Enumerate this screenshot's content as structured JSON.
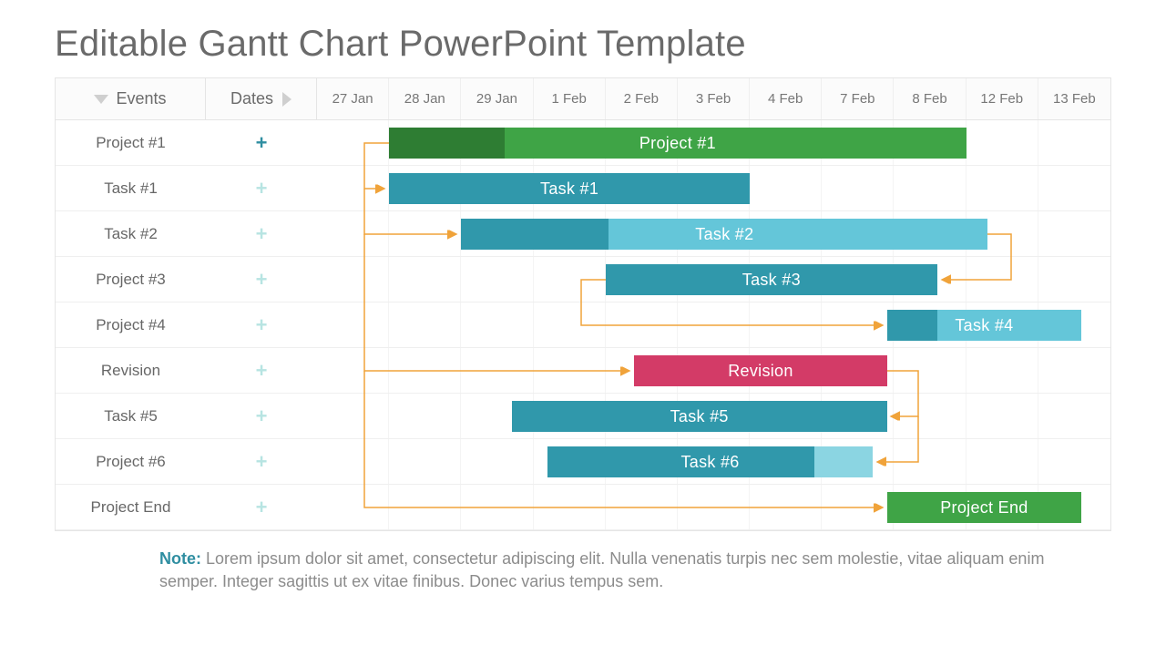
{
  "title": "Editable Gantt Chart PowerPoint Template",
  "columns": {
    "events": "Events",
    "dates": "Dates"
  },
  "timeline": [
    "27 Jan",
    "28 Jan",
    "29 Jan",
    "1 Feb",
    "2 Feb",
    "3 Feb",
    "4 Feb",
    "7 Feb",
    "8 Feb",
    "12 Feb",
    "13 Feb"
  ],
  "rows": [
    {
      "label": "Project #1",
      "icon": "plus-strong"
    },
    {
      "label": "Task #1",
      "icon": "plus"
    },
    {
      "label": "Task #2",
      "icon": "plus"
    },
    {
      "label": "Project #3",
      "icon": "plus"
    },
    {
      "label": "Project #4",
      "icon": "plus"
    },
    {
      "label": "Revision",
      "icon": "plus"
    },
    {
      "label": "Task #5",
      "icon": "plus"
    },
    {
      "label": "Project #6",
      "icon": "plus"
    },
    {
      "label": "Project End",
      "icon": "plus"
    }
  ],
  "note_label": "Note:",
  "note_text": "Lorem ipsum dolor sit amet, consectetur adipiscing elit. Nulla venenatis turpis nec sem molestie, vitae aliquam enim semper. Integer sagittis ut ex vitae finibus. Donec varius tempus sem.",
  "chart_data": {
    "type": "bar",
    "title": "Editable Gantt Chart PowerPoint Template",
    "x_categories": [
      "27 Jan",
      "28 Jan",
      "29 Jan",
      "1 Feb",
      "2 Feb",
      "3 Feb",
      "4 Feb",
      "7 Feb",
      "8 Feb",
      "12 Feb",
      "13 Feb"
    ],
    "series": [
      {
        "name": "Project #1",
        "row": 0,
        "start": 1,
        "end": 9,
        "progress": 0.2,
        "color": "#3fa446",
        "label": "Project #1"
      },
      {
        "name": "Task #1",
        "row": 1,
        "start": 1,
        "end": 6,
        "progress": 0,
        "color": "#3098ab",
        "label": "Task #1"
      },
      {
        "name": "Task #2",
        "row": 2,
        "start": 2,
        "end": 9.3,
        "progress": 0.28,
        "color": "#64c6d9",
        "label": "Task #2"
      },
      {
        "name": "Task #3",
        "row": 3,
        "start": 4,
        "end": 8.6,
        "progress": 0,
        "color": "#3098ab",
        "label": "Task #3"
      },
      {
        "name": "Task #4",
        "row": 4,
        "start": 7.9,
        "end": 10.6,
        "progress": 0.26,
        "color": "#64c6d9",
        "label": "Task #4"
      },
      {
        "name": "Revision",
        "row": 5,
        "start": 4.4,
        "end": 7.9,
        "progress": 0,
        "color": "#d33b67",
        "label": "Revision"
      },
      {
        "name": "Task #5",
        "row": 6,
        "start": 2.7,
        "end": 7.9,
        "progress": 0,
        "color": "#3098ab",
        "label": "Task #5"
      },
      {
        "name": "Task #6",
        "row": 7,
        "start": 3.2,
        "end": 7.7,
        "progress_tail": 0.18,
        "color": "#3098ab",
        "tail_color": "#8bd5e2",
        "label": "Task #6"
      },
      {
        "name": "Project End",
        "row": 8,
        "start": 7.9,
        "end": 10.6,
        "progress": 0,
        "color": "#3fa446",
        "label": "Project End"
      }
    ],
    "connectors": [
      {
        "from": "Project #1",
        "to": "Task #1"
      },
      {
        "from": "Project #1",
        "to": "Task #2"
      },
      {
        "from": "Task #2",
        "to": "Task #3"
      },
      {
        "from": "Task #3",
        "to": "Task #4",
        "from_side": "start"
      },
      {
        "from": "Project #1",
        "to": "Revision"
      },
      {
        "from": "Revision",
        "to": "Task #5"
      },
      {
        "from": "Revision",
        "to": "Task #6"
      },
      {
        "from": "Project #1",
        "to": "Project End"
      }
    ]
  }
}
